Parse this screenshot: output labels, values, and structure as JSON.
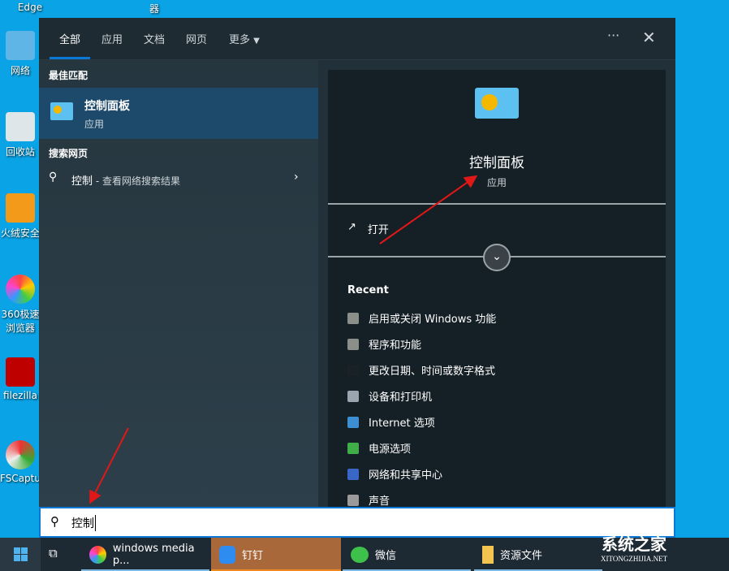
{
  "desktop": {
    "icons": [
      {
        "label": "Edge"
      },
      {
        "label": "器"
      },
      {
        "label": "网络"
      },
      {
        "label": "回收站"
      },
      {
        "label": "火绒安全"
      },
      {
        "label": "360极速浏览器"
      },
      {
        "label": "filezilla"
      },
      {
        "label": "FSCapture"
      }
    ]
  },
  "tabs": [
    {
      "label": "全部"
    },
    {
      "label": "应用"
    },
    {
      "label": "文档"
    },
    {
      "label": "网页"
    },
    {
      "label": "更多"
    }
  ],
  "more_icon": "ellipsis-icon",
  "close_icon": "close-icon",
  "left": {
    "best_match_heading": "最佳匹配",
    "best_match": {
      "title": "控制面板",
      "subtitle": "应用"
    },
    "web_heading": "搜索网页",
    "web_result": {
      "query": "控制",
      "suffix": " - 查看网络搜索结果"
    }
  },
  "right": {
    "title": "控制面板",
    "subtitle": "应用",
    "open_label": "打开",
    "recent_heading": "Recent",
    "recent": [
      {
        "label": "启用或关闭 Windows 功能",
        "color": "#8a8f8a"
      },
      {
        "label": "程序和功能",
        "color": "#8a8f8a"
      },
      {
        "label": "更改日期、时间或数字格式",
        "color": "#1a2228"
      },
      {
        "label": "设备和打印机",
        "color": "#9aa5b0"
      },
      {
        "label": "Internet 选项",
        "color": "#3d8fd1"
      },
      {
        "label": "电源选项",
        "color": "#3fae49"
      },
      {
        "label": "网络和共享中心",
        "color": "#3a66c8"
      },
      {
        "label": "声音",
        "color": "#9a9a9a"
      }
    ]
  },
  "search": {
    "value": "控制"
  },
  "taskbar": {
    "items": [
      {
        "label": "windows media p..."
      },
      {
        "label": "钉钉"
      },
      {
        "label": "微信"
      },
      {
        "label": "资源文件"
      }
    ]
  },
  "watermark": {
    "text": "系统之家",
    "url": "XITONGZHIJIA.NET"
  },
  "colors": {
    "accent": "#0a78d7",
    "desktop": "#0aa3e6",
    "highlight": "#1d4a6b",
    "dingtalk": "#a9683a"
  }
}
